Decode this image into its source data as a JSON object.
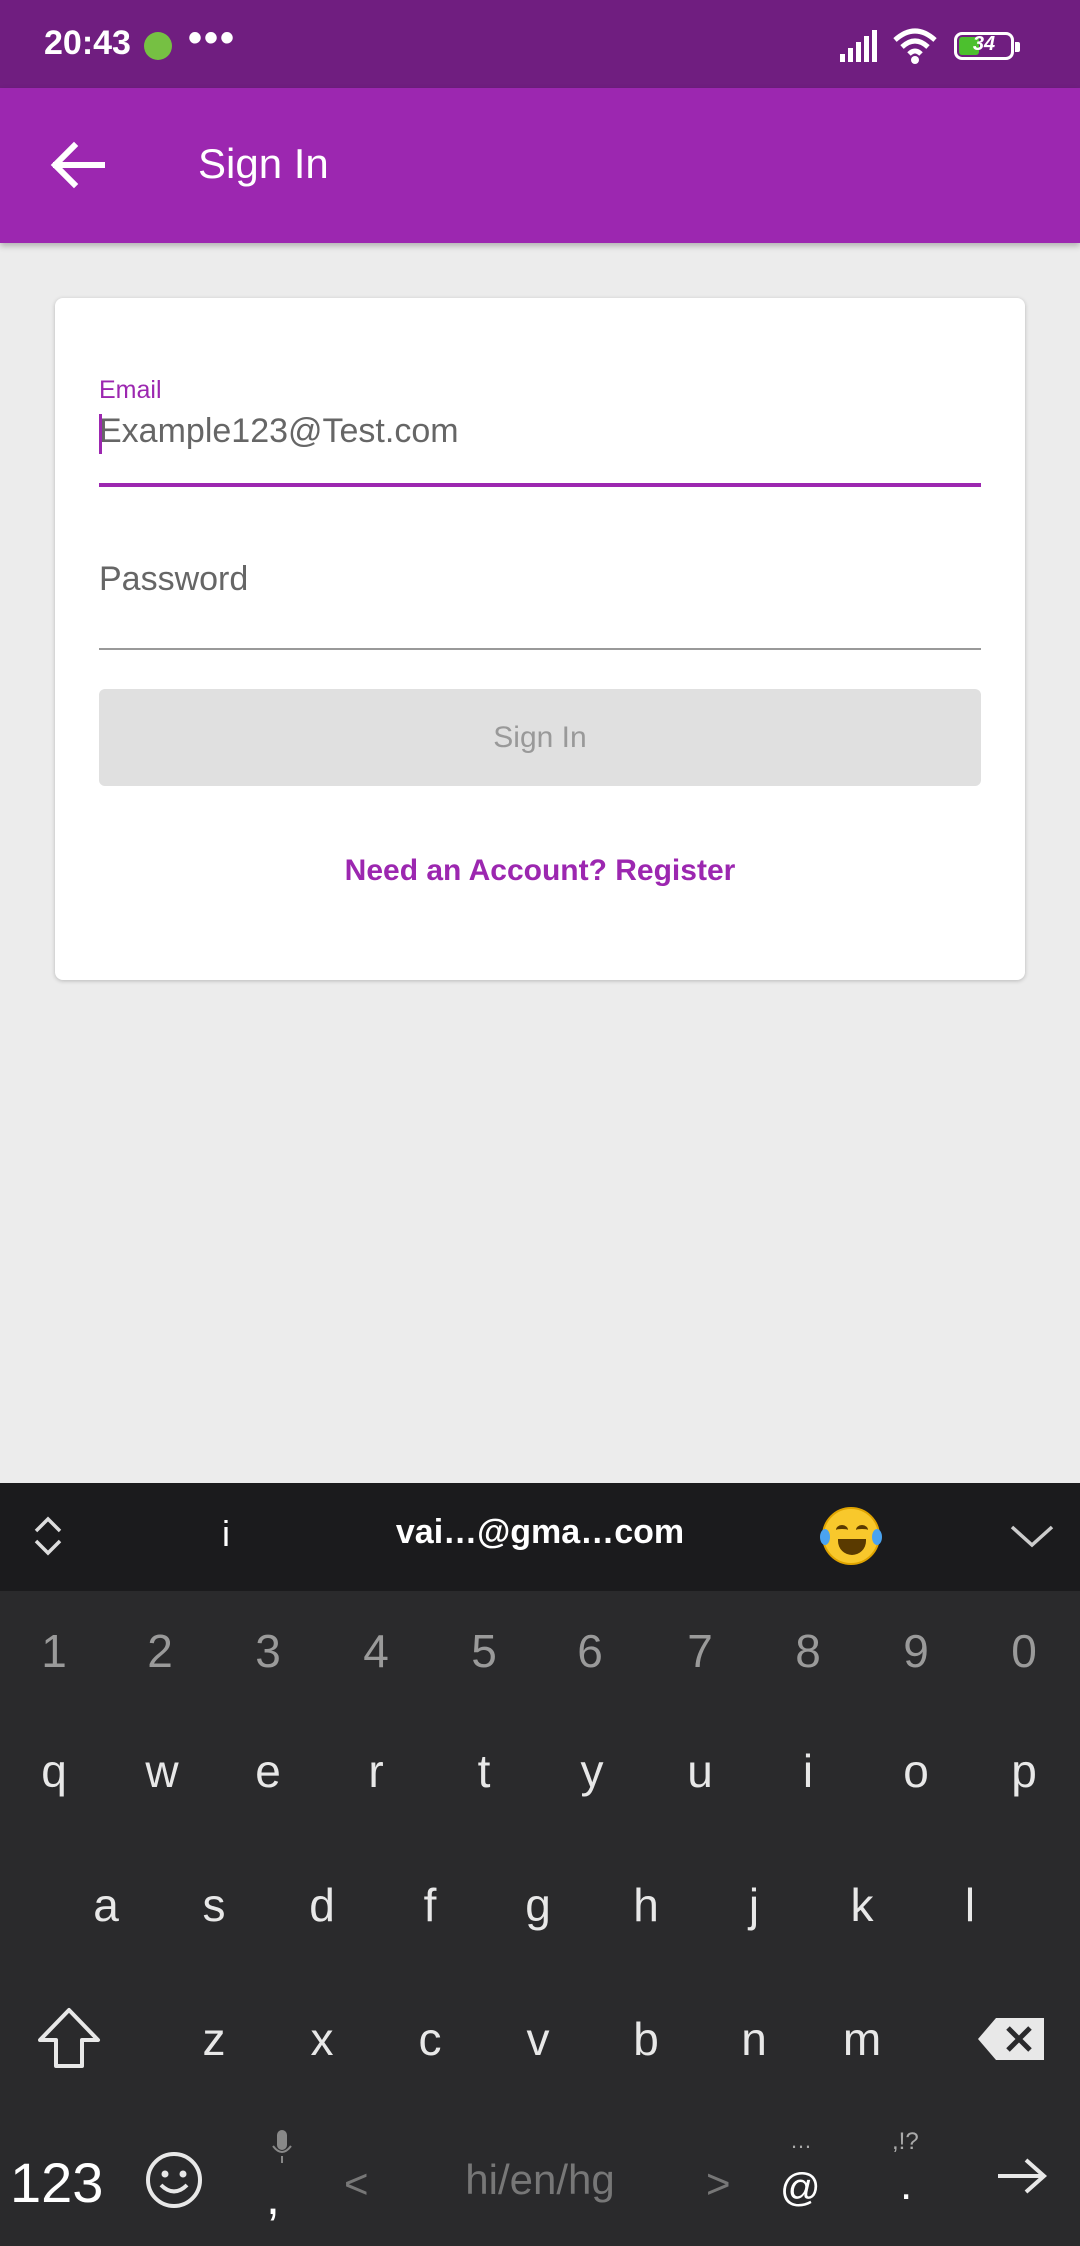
{
  "status_bar": {
    "time": "20:43",
    "dots": "•••",
    "battery_level": "34"
  },
  "app_bar": {
    "title": "Sign In",
    "back_icon": "arrow-left-icon",
    "color": "#9c27b0"
  },
  "form": {
    "email_label": "Email",
    "email_value": "Example123@Test.com",
    "password_label": "Password",
    "signin_label": "Sign In",
    "register_link": "Need an Account? Register",
    "accent": "#9c27b0"
  },
  "keyboard": {
    "suggestions": [
      "i",
      "vai…@gma…com"
    ],
    "emoji_suggestion": "laughing-crying-emoji",
    "number_row": [
      "1",
      "2",
      "3",
      "4",
      "5",
      "6",
      "7",
      "8",
      "9",
      "0"
    ],
    "row1": [
      "q",
      "w",
      "e",
      "r",
      "t",
      "y",
      "u",
      "i",
      "o",
      "p"
    ],
    "row2": [
      "a",
      "s",
      "d",
      "f",
      "g",
      "h",
      "j",
      "k",
      "l"
    ],
    "row3": [
      "z",
      "x",
      "c",
      "v",
      "b",
      "n",
      "m"
    ],
    "mode_key": "123",
    "comma": ",",
    "language": "hi/en/hg",
    "lang_prev": "<",
    "lang_next": ">",
    "at_hint": "…",
    "at_key": "@",
    "punct_hint": ",!?",
    "period": "."
  }
}
